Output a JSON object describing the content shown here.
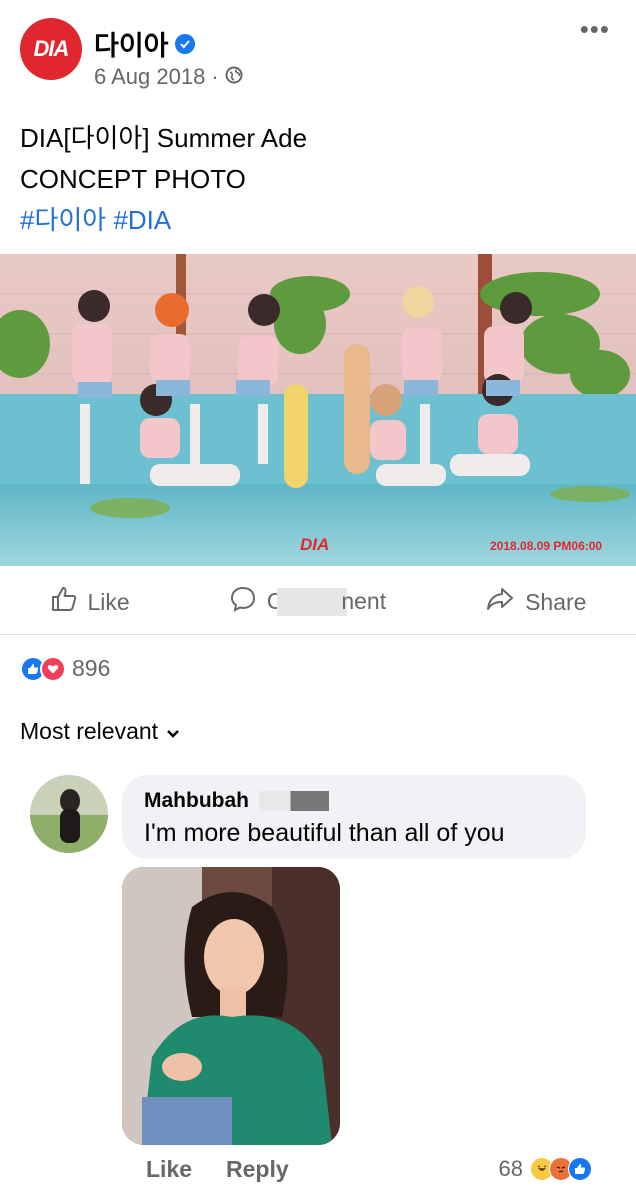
{
  "post": {
    "page_logo_text": "DIA",
    "page_name": "다이아",
    "date": "6 Aug 2018",
    "date_separator": "·",
    "caption_line1": "DIA[다이아] Summer Ade",
    "caption_line2": "CONCEPT PHOTO",
    "hashtags": "#다이아 #DIA",
    "photo_logo": "DIA",
    "photo_timestamp": "2018.08.09 PM06:00"
  },
  "actions": {
    "like_label": "Like",
    "comment_left": "C",
    "comment_right": "nent",
    "share_label": "Share"
  },
  "reactions": {
    "count": "896"
  },
  "sort": {
    "label": "Most relevant"
  },
  "comment": {
    "author": "Mahbubah",
    "text": "I'm more beautiful than all of you",
    "like_label": "Like",
    "reply_label": "Reply",
    "reaction_count": "68"
  },
  "colors": {
    "brand_red": "#e0262f",
    "facebook_blue": "#1877f2",
    "love_red": "#f33e58",
    "hashtag_blue": "#216fdb",
    "secondary_text": "#65676b"
  },
  "icons": [
    "dia-logo",
    "verified-icon",
    "globe-icon",
    "more-icon",
    "like-icon",
    "comment-icon",
    "share-icon",
    "like-reaction-icon",
    "love-reaction-icon",
    "chevron-down-icon",
    "haha-reaction-icon",
    "angry-reaction-icon"
  ]
}
